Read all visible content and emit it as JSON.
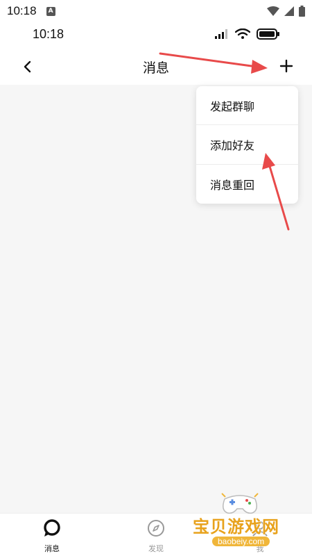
{
  "system_status": {
    "time": "10:18",
    "notification_icon": "a-icon",
    "right_icons": [
      "wifi-icon",
      "signal-icon",
      "battery-icon"
    ]
  },
  "app_status": {
    "time": "10:18",
    "right_icons": [
      "cell-signal-icon",
      "wifi-icon",
      "battery-icon"
    ]
  },
  "header": {
    "back_icon": "chevron-left-icon",
    "title": "消息",
    "plus_icon": "plus-icon"
  },
  "popup_menu": {
    "items": [
      {
        "label": "发起群聊"
      },
      {
        "label": "添加好友"
      },
      {
        "label": "消息重回"
      }
    ]
  },
  "bottom_nav": {
    "items": [
      {
        "label": "消息",
        "icon": "chat-bubble-icon",
        "active": true
      },
      {
        "label": "发现",
        "icon": "compass-icon",
        "active": false
      },
      {
        "label": "我",
        "icon": "user-icon",
        "active": false
      }
    ]
  },
  "watermark": {
    "title": "宝贝游戏网",
    "url": "baobeiy.com"
  },
  "colors": {
    "content_bg": "#f6f6f6",
    "annotation_arrow": "#e84a4a",
    "watermark": "#e8a21c",
    "active_nav": "#111111",
    "inactive_nav": "#999999"
  }
}
